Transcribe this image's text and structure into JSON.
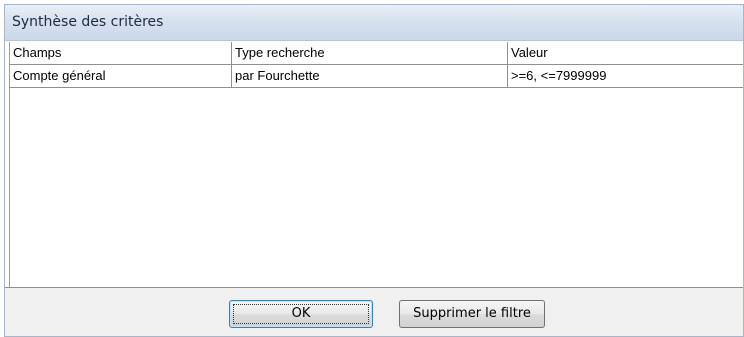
{
  "dialog": {
    "title": "Synthèse des critères"
  },
  "table": {
    "columns": [
      "Champs",
      "Type recherche",
      "Valeur"
    ],
    "rows": [
      [
        "Compte général",
        "par Fourchette",
        ">=6, <=7999999"
      ]
    ]
  },
  "buttons": {
    "ok_label": "OK",
    "remove_filter_label": "Supprimer le filtre"
  }
}
